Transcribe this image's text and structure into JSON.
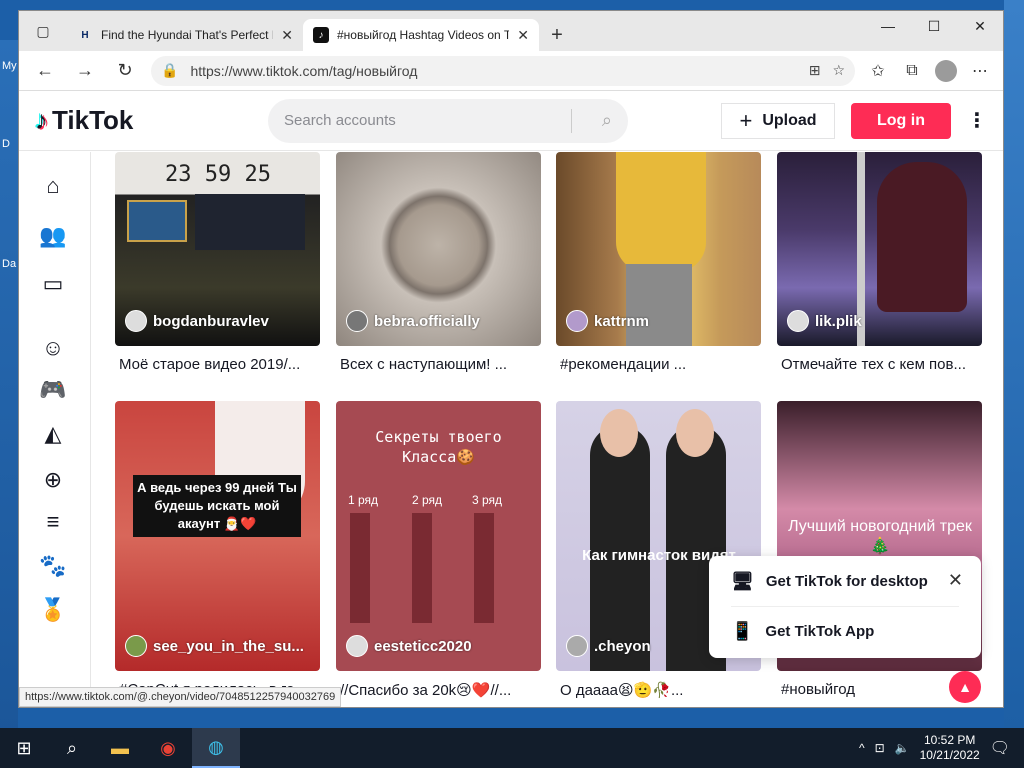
{
  "desktop": {
    "left_labels": [
      "My",
      "D",
      "Da"
    ]
  },
  "browser": {
    "tabs": [
      {
        "title": "Find the Hyundai That's Perfect F",
        "active": false,
        "favicon": "H"
      },
      {
        "title": "#новыйгод Hashtag Videos on T",
        "active": true,
        "favicon": "♪"
      }
    ],
    "url": "https://www.tiktok.com/tag/новыйгод",
    "status_url": "https://www.tiktok.com/@.cheyon/video/7048512257940032769"
  },
  "tiktok": {
    "logo": "TikTok",
    "search_placeholder": "Search accounts",
    "upload_label": "Upload",
    "login_label": "Log in",
    "videos": [
      {
        "user": "bogdanburavlev",
        "caption": "Моё старое видео 2019/...",
        "overlay": "23 59 25"
      },
      {
        "user": "bebra.officially",
        "caption": "Всех с наступающим! ...",
        "overlay": ""
      },
      {
        "user": "kattrnm",
        "caption": "#рекомендации ...",
        "overlay": ""
      },
      {
        "user": "lik.plik",
        "caption": "Отмечайте тех с кем пов...",
        "overlay": ""
      },
      {
        "user": "see_you_in_the_su...",
        "caption": "#CapCut я родилась, в го...",
        "overlay": "А ведь через 99 дней Ты будешь искать мой акаунт 🎅❤️"
      },
      {
        "user": "eesteticc2020",
        "caption": "//Спасибо за 20k😢❤️//...",
        "overlay": "Секреты твоего Класса🍪"
      },
      {
        "user": ".cheyon",
        "caption": "О дaaaa😫🫡🥀...",
        "overlay": "Как гимнасток видят"
      },
      {
        "user": "",
        "caption": "#новыйгод",
        "overlay": "Лучший новогодний трек 🎄"
      }
    ],
    "grid_labels": {
      "r1": "1 ряд",
      "r2": "2 ряд",
      "r3": "3 ряд"
    },
    "popup": {
      "desktop": "Get TikTok for desktop",
      "app": "Get TikTok App"
    }
  },
  "taskbar": {
    "time": "10:52 PM",
    "date": "10/21/2022"
  }
}
